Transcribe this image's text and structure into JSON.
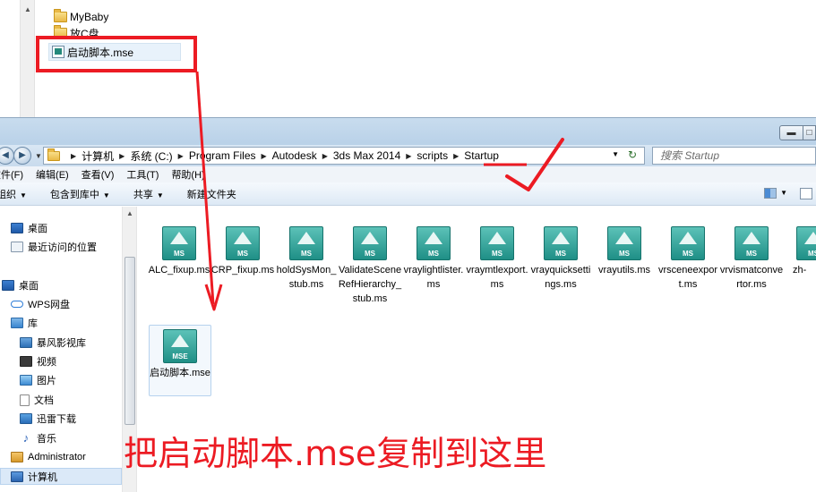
{
  "top_pane": {
    "items": [
      {
        "label": "MyBaby",
        "icon": "folder-icon"
      },
      {
        "label": "放C盘",
        "icon": "folder-icon"
      },
      {
        "label": "启动脚本.mse",
        "icon": "mse-file-icon"
      }
    ]
  },
  "navbar": {
    "back_glyph": "◀",
    "forward_glyph": "▶",
    "breadcrumbs": [
      "计算机",
      "系统 (C:)",
      "Program Files",
      "Autodesk",
      "3ds Max 2014",
      "scripts",
      "Startup"
    ],
    "refresh_glyph": "↻",
    "search_placeholder": "搜索 Startup"
  },
  "menubar": [
    "文件(F)",
    "编辑(E)",
    "查看(V)",
    "工具(T)",
    "帮助(H)"
  ],
  "toolbar": {
    "organize": "组织",
    "include_library": "包含到库中",
    "share": "共享",
    "new_folder": "新建文件夹"
  },
  "sidebar": {
    "items": [
      {
        "label": "桌面",
        "icon": "desktop-icon"
      },
      {
        "label": "最近访问的位置",
        "icon": "recent-places-icon"
      },
      {
        "label": "桌面",
        "icon": "desktop-icon"
      },
      {
        "label": "WPS网盘",
        "icon": "cloud-icon"
      },
      {
        "label": "库",
        "icon": "library-icon"
      },
      {
        "label": "暴风影视库",
        "icon": "media-library-icon"
      },
      {
        "label": "视频",
        "icon": "video-icon"
      },
      {
        "label": "图片",
        "icon": "picture-icon"
      },
      {
        "label": "文档",
        "icon": "document-icon"
      },
      {
        "label": "迅雷下载",
        "icon": "download-icon"
      },
      {
        "label": "音乐",
        "icon": "music-icon"
      },
      {
        "label": "Administrator",
        "icon": "user-icon"
      },
      {
        "label": "计算机",
        "icon": "computer-icon"
      }
    ]
  },
  "files": [
    {
      "name": "ALC_fixup.ms",
      "badge": "MS"
    },
    {
      "name": "CRP_fixup.ms",
      "badge": "MS"
    },
    {
      "name": "holdSysMon_stub.ms",
      "badge": "MS"
    },
    {
      "name": "ValidateSceneRefHierarchy_stub.ms",
      "badge": "MS"
    },
    {
      "name": "vraylightlister.ms",
      "badge": "MS"
    },
    {
      "name": "vraymtlexport.ms",
      "badge": "MS"
    },
    {
      "name": "vrayquicksettings.ms",
      "badge": "MS"
    },
    {
      "name": "vrayutils.ms",
      "badge": "MS"
    },
    {
      "name": "vrsceneexport.ms",
      "badge": "MS"
    },
    {
      "name": "vrvismatconvertor.ms",
      "badge": "MS"
    },
    {
      "name": "zh-",
      "badge": "MS"
    }
  ],
  "copied_file": {
    "name": "启动脚本.mse",
    "badge": "MSE"
  },
  "annotation": {
    "caption": "把启动脚本.mse复制到这里",
    "color": "#ec1b23"
  }
}
